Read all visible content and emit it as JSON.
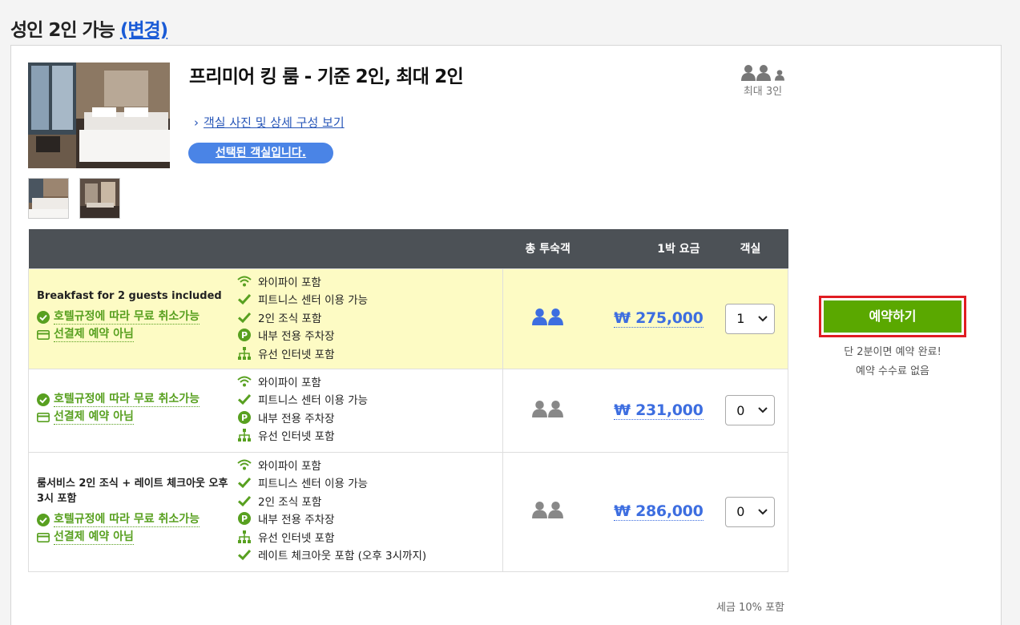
{
  "header": {
    "title": "성인 2인 가능",
    "change_label": "(변경)"
  },
  "room": {
    "title": "프리미어 킹 룸 - 기준 2인, 최대 2인",
    "detail_link": "객실 사진 및 상세 구성 보기",
    "selected_label": "선택된 객실입니다.",
    "max_occupancy": "최대 3인"
  },
  "table": {
    "headers": {
      "guests": "총 투숙객",
      "price": "1박 요금",
      "rooms": "객실"
    },
    "rows": [
      {
        "name": "Breakfast for 2 guests included",
        "cancel": "호텔규정에 따라 무료 취소가능",
        "prepay": "선결제 예약 아님",
        "amenities": [
          {
            "icon": "wifi-icon",
            "text": "와이파이 포함"
          },
          {
            "icon": "check-icon",
            "text": "피트니스 센터 이용 가능"
          },
          {
            "icon": "check-icon",
            "text": "2인 조식 포함"
          },
          {
            "icon": "parking-icon",
            "text": "내부 전용 주차장"
          },
          {
            "icon": "network-icon",
            "text": "유선 인터넷 포함"
          }
        ],
        "price": "₩ 275,000",
        "qty": "1",
        "selected": true
      },
      {
        "name": "",
        "cancel": "호텔규정에 따라 무료 취소가능",
        "prepay": "선결제 예약 아님",
        "amenities": [
          {
            "icon": "wifi-icon",
            "text": "와이파이 포함"
          },
          {
            "icon": "check-icon",
            "text": "피트니스 센터 이용 가능"
          },
          {
            "icon": "parking-icon",
            "text": "내부 전용 주차장"
          },
          {
            "icon": "network-icon",
            "text": "유선 인터넷 포함"
          }
        ],
        "price": "₩ 231,000",
        "qty": "0",
        "selected": false
      },
      {
        "name": "룸서비스 2인 조식 + 레이트 체크아웃 오후 3시 포함",
        "cancel": "호텔규정에 따라 무료 취소가능",
        "prepay": "선결제 예약 아님",
        "amenities": [
          {
            "icon": "wifi-icon",
            "text": "와이파이 포함"
          },
          {
            "icon": "check-icon",
            "text": "피트니스 센터 이용 가능"
          },
          {
            "icon": "check-icon",
            "text": "2인 조식 포함"
          },
          {
            "icon": "parking-icon",
            "text": "내부 전용 주차장"
          },
          {
            "icon": "network-icon",
            "text": "유선 인터넷 포함"
          },
          {
            "icon": "check-icon",
            "text": "레이트 체크아웃 포함 (오후 3시까지)"
          }
        ],
        "price": "₩ 286,000",
        "qty": "0",
        "selected": false
      }
    ]
  },
  "booking": {
    "button_label": "예약하기",
    "note_line1": "단 2분이면 예약 완료!",
    "note_line2": "예약 수수료 없음"
  },
  "tax_note": "세금 10% 포함",
  "colors": {
    "accent_blue": "#3d6ee0",
    "book_green": "#5aa800",
    "highlight_row": "#fdfbc4",
    "book_border": "#e01c22",
    "table_header": "#4c5156"
  }
}
